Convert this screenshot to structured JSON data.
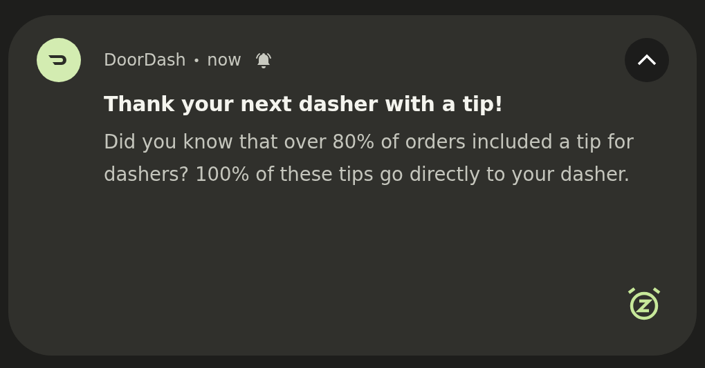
{
  "notification": {
    "app_name": "DoorDash",
    "separator": "•",
    "time": "now",
    "alerting": true,
    "expanded": true,
    "title": "Thank your next dasher with a tip!",
    "body": "Did you know that over 80% of orders included a tip for dashers? 100% of these tips go directly to your dasher."
  }
}
